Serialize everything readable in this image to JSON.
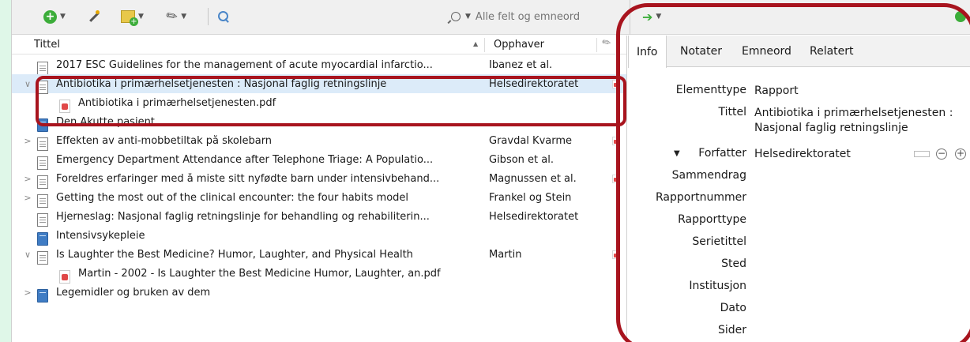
{
  "colors": {
    "accent_red": "#a8141e",
    "selection": "#dcebf9",
    "background": "#dff7e8"
  },
  "toolbar": {
    "new_item_icon": "plus-circle-icon",
    "add_by_identifier_icon": "wand-icon",
    "new_note_icon": "note-icon",
    "attachment_icon": "paperclip-icon",
    "advanced_search_icon": "magnifier-icon",
    "search_mode": "Alle felt og emneord",
    "search_value": ""
  },
  "list": {
    "col_title": "Tittel",
    "col_creator": "Opphaver",
    "rows": [
      {
        "title": "2017 ESC Guidelines for the management of acute myocardial infarctio...",
        "creator": "Ibanez et al.",
        "icon": "document",
        "twisty": "",
        "attachment": false,
        "child": false,
        "selected": false
      },
      {
        "title": "Antibiotika i primærhelsetjenesten : Nasjonal faglig retningslinje",
        "creator": "Helsedirektoratet",
        "icon": "document",
        "twisty": "∨",
        "attachment": true,
        "child": false,
        "selected": true
      },
      {
        "title": "Antibiotika i primærhelsetjenesten.pdf",
        "creator": "",
        "icon": "pdf",
        "twisty": "",
        "attachment": false,
        "child": true,
        "selected": false
      },
      {
        "title": "Den Akutte pasient",
        "creator": "",
        "icon": "book",
        "twisty": "",
        "attachment": false,
        "child": false,
        "selected": false
      },
      {
        "title": "Effekten av anti-mobbetiltak på skolebarn",
        "creator": "Gravdal Kvarme",
        "icon": "document",
        "twisty": ">",
        "attachment": true,
        "child": false,
        "selected": false
      },
      {
        "title": "Emergency Department Attendance after Telephone Triage: A Populatio...",
        "creator": "Gibson et al.",
        "icon": "document",
        "twisty": "",
        "attachment": false,
        "child": false,
        "selected": false
      },
      {
        "title": "Foreldres erfaringer med å miste sitt nyfødte barn under intensivbehand...",
        "creator": "Magnussen et al.",
        "icon": "document",
        "twisty": ">",
        "attachment": true,
        "child": false,
        "selected": false
      },
      {
        "title": "Getting the most out of the clinical encounter: the four habits model",
        "creator": "Frankel og Stein",
        "icon": "document",
        "twisty": ">",
        "attachment": false,
        "child": false,
        "selected": false
      },
      {
        "title": "Hjerneslag: Nasjonal faglig retningslinje for behandling og rehabiliterin...",
        "creator": "Helsedirektoratet",
        "icon": "page",
        "twisty": "",
        "attachment": false,
        "child": false,
        "selected": false
      },
      {
        "title": "Intensivsykepleie",
        "creator": "",
        "icon": "book",
        "twisty": "",
        "attachment": false,
        "child": false,
        "selected": false
      },
      {
        "title": "Is Laughter the Best Medicine? Humor, Laughter, and Physical Health",
        "creator": "Martin",
        "icon": "document",
        "twisty": "∨",
        "attachment": true,
        "child": false,
        "selected": false
      },
      {
        "title": "Martin - 2002 - Is Laughter the Best Medicine Humor, Laughter, an.pdf",
        "creator": "",
        "icon": "pdf",
        "twisty": "",
        "attachment": false,
        "child": true,
        "selected": false
      },
      {
        "title": "Legemidler og bruken av dem",
        "creator": "",
        "icon": "book",
        "twisty": ">",
        "attachment": false,
        "child": false,
        "selected": false
      }
    ]
  },
  "pane": {
    "tabs": [
      "Info",
      "Notater",
      "Emneord",
      "Relatert"
    ],
    "active_tab": "Info",
    "fields": [
      {
        "label": "Elementtype",
        "value": "Rapport"
      },
      {
        "label": "Tittel",
        "value": "Antibiotika i primærhelsetjenesten :",
        "value2": "Nasjonal faglig retningslinje"
      },
      {
        "label": "Forfatter",
        "value": "Helsedirektoratet"
      },
      {
        "label": "Sammendrag",
        "value": ""
      },
      {
        "label": "Rapportnummer",
        "value": ""
      },
      {
        "label": "Rapporttype",
        "value": ""
      },
      {
        "label": "Serietittel",
        "value": ""
      },
      {
        "label": "Sted",
        "value": ""
      },
      {
        "label": "Institusjon",
        "value": ""
      },
      {
        "label": "Dato",
        "value": ""
      },
      {
        "label": "Sider",
        "value": ""
      }
    ]
  }
}
